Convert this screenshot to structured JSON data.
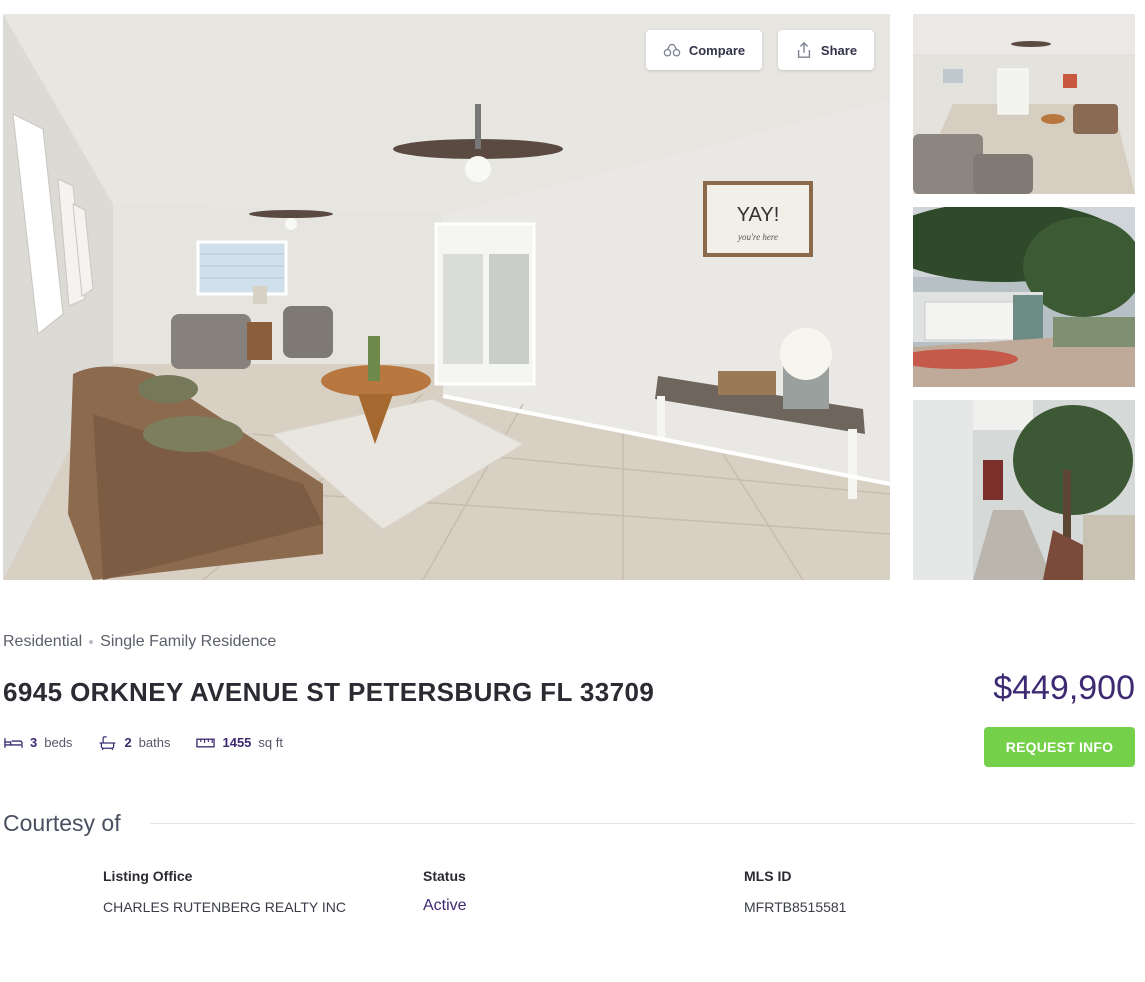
{
  "gallery": {
    "main_photo_alt": "Living room",
    "compare_label": "Compare",
    "share_label": "Share",
    "wall_sign_text": "YAY!",
    "wall_sign_sub": "you're here"
  },
  "listing": {
    "category": "Residential",
    "subtype": "Single Family Residence",
    "address": "6945 ORKNEY AVENUE ST PETERSBURG FL 33709",
    "price": "$449,900",
    "beds_count": "3",
    "beds_label": "beds",
    "baths_count": "2",
    "baths_label": "baths",
    "sqft_count": "1455",
    "sqft_label": "sq ft",
    "request_label": "REQUEST INFO"
  },
  "courtesy": {
    "heading": "Courtesy of",
    "office_label": "Listing Office",
    "office_value": "CHARLES RUTENBERG REALTY INC",
    "status_label": "Status",
    "status_value": "Active",
    "mls_label": "MLS ID",
    "mls_value": "MFRTB8515581"
  },
  "colors": {
    "accent_purple": "#3d2a72",
    "request_green": "#76d14a"
  }
}
